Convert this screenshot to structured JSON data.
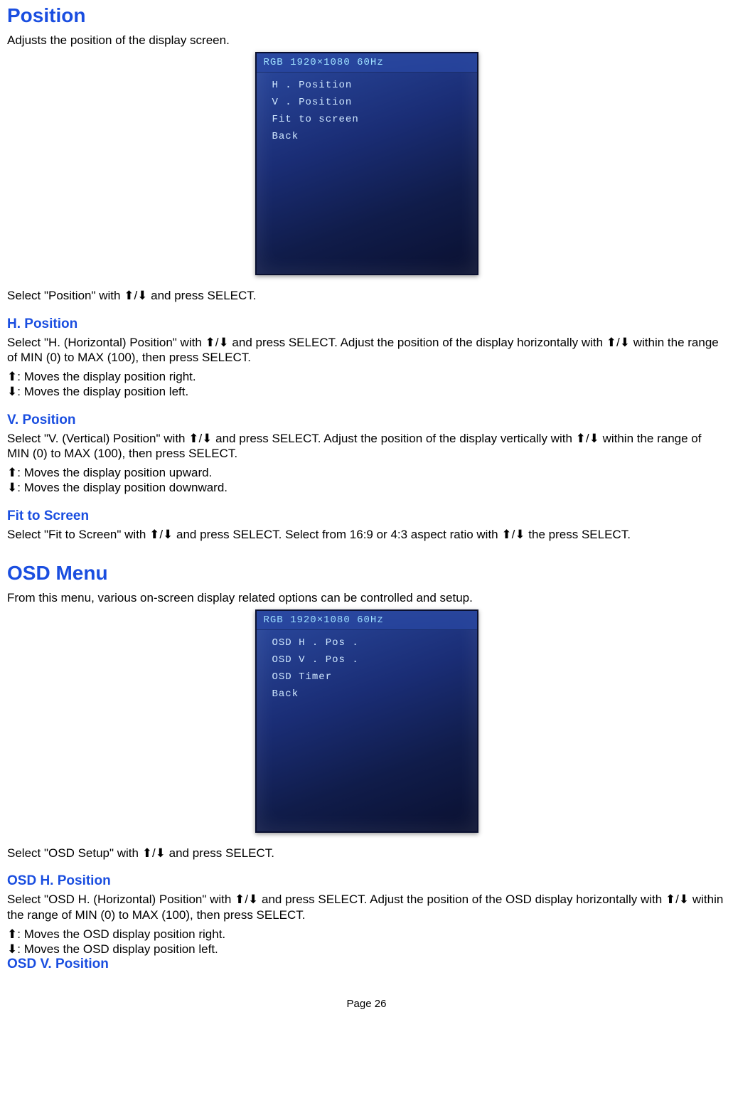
{
  "position": {
    "title": "Position",
    "intro": "Adjusts the position of the display screen.",
    "select_text": "Select \"Position\" with ⬆/⬇ and press SELECT."
  },
  "osd_screenshot_1": {
    "header": "RGB  1920×1080  60Hz",
    "items": [
      "H . Position",
      "V . Position",
      "Fit  to  screen",
      "Back"
    ]
  },
  "h_position": {
    "title": "H. Position",
    "para": "Select \"H. (Horizontal) Position\" with ⬆/⬇ and press SELECT. Adjust the position of the display horizontally with ⬆/⬇ within the range of MIN (0) to MAX (100), then press SELECT.",
    "up": "⬆: Moves the display position right.",
    "down": "⬇: Moves the display position left."
  },
  "v_position": {
    "title": "V. Position",
    "para": "Select \"V. (Vertical) Position\" with ⬆/⬇ and press SELECT. Adjust the position of the display vertically with ⬆/⬇ within the range of MIN (0) to MAX (100), then press SELECT.",
    "up": "⬆: Moves the display position upward.",
    "down": "⬇: Moves the display position downward."
  },
  "fit": {
    "title": "Fit to Screen",
    "para": "Select \"Fit to Screen\" with ⬆/⬇ and press SELECT. Select from 16:9 or 4:3 aspect ratio with ⬆/⬇ the press SELECT."
  },
  "osd_menu": {
    "title": "OSD Menu",
    "intro": "From this menu, various on-screen display related options can be controlled and setup.",
    "select_text": "Select \"OSD Setup\" with ⬆/⬇ and press SELECT."
  },
  "osd_screenshot_2": {
    "header": "RGB  1920×1080  60Hz",
    "items": [
      "OSD  H . Pos .",
      "OSD  V . Pos .",
      "OSD  Timer",
      "Back"
    ]
  },
  "osd_h": {
    "title": "OSD H. Position",
    "para": "Select \"OSD H. (Horizontal) Position\" with ⬆/⬇ and press SELECT. Adjust the position of the OSD display horizontally with ⬆/⬇ within the range of MIN (0) to MAX (100), then press SELECT.",
    "up": "⬆: Moves the OSD display position right.",
    "down": "⬇: Moves the OSD display position left."
  },
  "osd_v": {
    "title": "OSD V. Position"
  },
  "footer": "Page 26"
}
